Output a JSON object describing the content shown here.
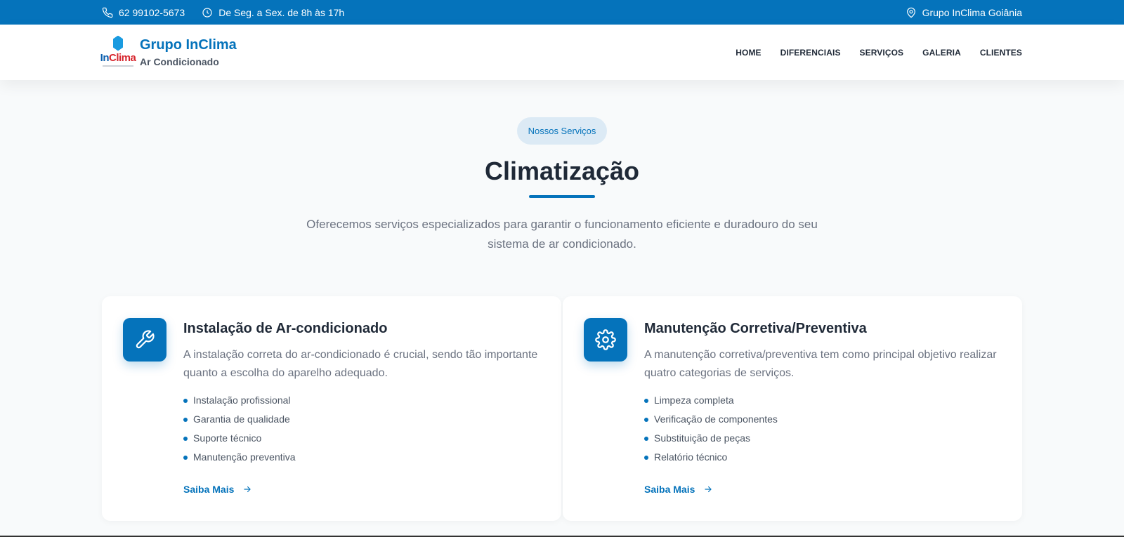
{
  "topbar": {
    "phone": "62 99102-5673",
    "hours": "De Seg. a Sex. de 8h às 17h",
    "location": "Grupo InClima Goiânia"
  },
  "header": {
    "logo_text_blue": "In",
    "logo_text_red": "Clima",
    "brand_title": "Grupo InClima",
    "brand_subtitle": "Ar Condicionado",
    "nav": [
      "HOME",
      "DIFERENCIAIS",
      "SERVIÇOS",
      "GALERIA",
      "CLIENTES"
    ]
  },
  "section": {
    "badge": "Nossos Serviços",
    "title": "Climatização",
    "lead": "Oferecemos serviços especializados para garantir o funcionamento eficiente e duradouro do seu sistema de ar condicionado."
  },
  "cards": [
    {
      "icon": "wrench-icon",
      "title": "Instalação de Ar-condicionado",
      "description": "A instalação correta do ar-condicionado é crucial, sendo tão importante quanto a escolha do aparelho adequado.",
      "items": [
        "Instalação profissional",
        "Garantia de qualidade",
        "Suporte técnico",
        "Manutenção preventiva"
      ],
      "link": "Saiba Mais"
    },
    {
      "icon": "gear-icon",
      "title": "Manutenção Corretiva/Preventiva",
      "description": "A manutenção corretiva/preventiva tem como principal objetivo realizar quatro categorias de serviços.",
      "items": [
        "Limpeza completa",
        "Verificação de componentes",
        "Substituição de peças",
        "Relatório técnico"
      ],
      "link": "Saiba Mais"
    }
  ],
  "colors": {
    "primary": "#0573bb",
    "badge_bg": "#dceaf5",
    "background": "#f8fafb"
  }
}
